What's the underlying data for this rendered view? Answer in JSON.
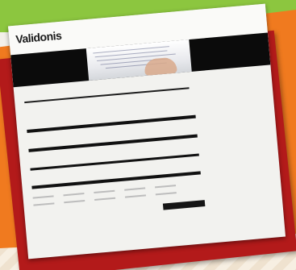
{
  "background": {
    "green": "#8cc63f",
    "orange": "#f07a1f",
    "red": "#b31a1a",
    "cream": "#f3f0ea"
  },
  "page": {
    "logo": "Validonis",
    "nav_items": [
      "",
      "",
      "",
      "",
      "",
      ""
    ],
    "top_right_text": "",
    "section_heading": "",
    "intro_text": "",
    "rows": [
      {
        "label": ""
      },
      {
        "label": ""
      },
      {
        "label": ""
      },
      {
        "label": ""
      }
    ],
    "submit_label": "",
    "footer_left": "",
    "footer_right": ""
  }
}
